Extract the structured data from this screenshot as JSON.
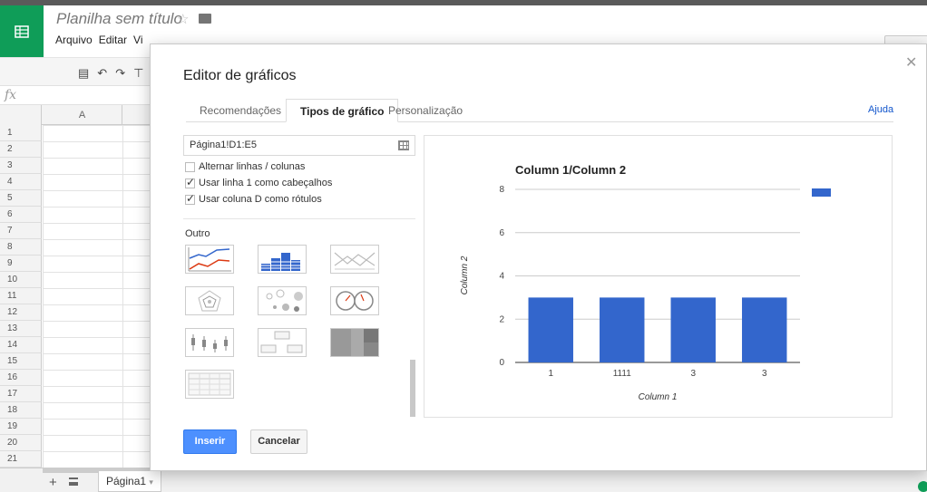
{
  "document": {
    "title": "Planilha sem título"
  },
  "menu": [
    "Arquivo",
    "Editar",
    "Vi"
  ],
  "formula": {
    "fx": "fx"
  },
  "grid": {
    "column_headers": [
      "A"
    ],
    "row_numbers": [
      "1",
      "2",
      "3",
      "4",
      "5",
      "6",
      "7",
      "8",
      "9",
      "10",
      "11",
      "12",
      "13",
      "14",
      "15",
      "16",
      "17",
      "18",
      "19",
      "20",
      "21"
    ]
  },
  "sheet_tabs": {
    "active": "Página1"
  },
  "dialog": {
    "title": "Editor de gráficos",
    "tabs": [
      "Recomendações",
      "Tipos de gráfico",
      "Personalização"
    ],
    "active_tab": "Tipos de gráfico",
    "help_link": "Ajuda",
    "range": "Página1!D1:E5",
    "options": [
      {
        "label": "Alternar linhas / colunas",
        "checked": false
      },
      {
        "label": "Usar linha 1 como cabeçalhos",
        "checked": true
      },
      {
        "label": "Usar coluna D como rótulos",
        "checked": true
      }
    ],
    "section_label": "Outro",
    "chart_type_thumbnails": [
      "line-chart-icon",
      "stepped-bar-chart-icon",
      "area-line-chart-icon",
      "radar-chart-icon",
      "bubble-chart-icon",
      "gauge-chart-icon",
      "candlestick-chart-icon",
      "org-chart-icon",
      "treemap-chart-icon",
      "table-chart-icon"
    ],
    "insert_label": "Inserir",
    "cancel_label": "Cancelar"
  },
  "chart_data": {
    "type": "bar",
    "title": "Column 1/Column 2",
    "xlabel": "Column 1",
    "ylabel": "Column 2",
    "categories": [
      "1",
      "1111",
      "3",
      "3"
    ],
    "series": [
      {
        "values": [
          3,
          3,
          3,
          3
        ]
      }
    ],
    "ylim": [
      0,
      8
    ],
    "yticks": [
      0,
      2,
      4,
      6,
      8
    ],
    "grid": true,
    "legend": "right",
    "bar_color": "#3366cc"
  },
  "colors": {
    "sheets_green": "#0f9d58",
    "accent_blue": "#4d90fe",
    "link_blue": "#1155cc"
  }
}
